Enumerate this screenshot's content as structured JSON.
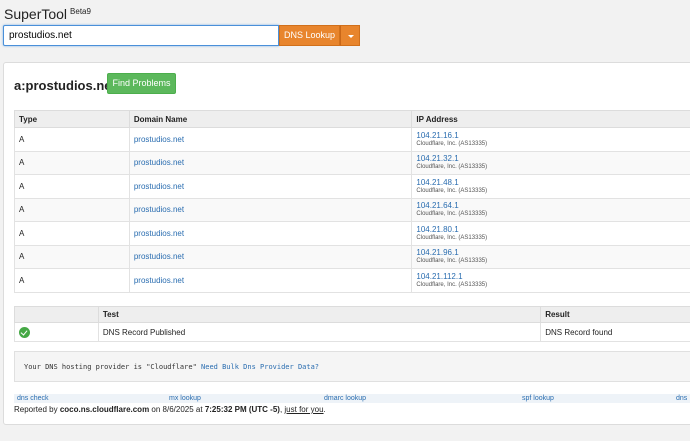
{
  "app": {
    "title": "SuperTool",
    "badge": "Beta9"
  },
  "search": {
    "value": "prostudios.net",
    "lookup_label": "DNS Lookup"
  },
  "result": {
    "title": "a:prostudios.net",
    "find_problems_label": "Find Problems"
  },
  "dns_table": {
    "headers": [
      "Type",
      "Domain Name",
      "IP Address"
    ],
    "rows": [
      {
        "type": "A",
        "domain": "prostudios.net",
        "ip": "104.21.16.1",
        "org": "Cloudflare, Inc. (AS13335)"
      },
      {
        "type": "A",
        "domain": "prostudios.net",
        "ip": "104.21.32.1",
        "org": "Cloudflare, Inc. (AS13335)"
      },
      {
        "type": "A",
        "domain": "prostudios.net",
        "ip": "104.21.48.1",
        "org": "Cloudflare, Inc. (AS13335)"
      },
      {
        "type": "A",
        "domain": "prostudios.net",
        "ip": "104.21.64.1",
        "org": "Cloudflare, Inc. (AS13335)"
      },
      {
        "type": "A",
        "domain": "prostudios.net",
        "ip": "104.21.80.1",
        "org": "Cloudflare, Inc. (AS13335)"
      },
      {
        "type": "A",
        "domain": "prostudios.net",
        "ip": "104.21.96.1",
        "org": "Cloudflare, Inc. (AS13335)"
      },
      {
        "type": "A",
        "domain": "prostudios.net",
        "ip": "104.21.112.1",
        "org": "Cloudflare, Inc. (AS13335)"
      }
    ]
  },
  "test_table": {
    "headers": [
      "",
      "Test",
      "Result"
    ],
    "rows": [
      {
        "status_icon": "check-circle-icon",
        "test": "DNS Record Published",
        "result": "DNS Record found"
      }
    ]
  },
  "provider": {
    "text": "Your DNS hosting provider is \"Cloudflare\"",
    "link": "Need Bulk Dns Provider Data?"
  },
  "links": [
    "dns check",
    "mx lookup",
    "dmarc lookup",
    "spf lookup",
    "dns"
  ],
  "reported": {
    "prefix": "Reported by",
    "server": "coco.ns.cloudflare.com",
    "on": "on 8/6/2025 at",
    "time": "7:25:32 PM (UTC -5)",
    "sep": ",",
    "just_for_you": "just for you",
    "end": "."
  },
  "colors": {
    "accent": "#e8852d",
    "success": "#5cb85c",
    "link": "#2a6db0"
  }
}
